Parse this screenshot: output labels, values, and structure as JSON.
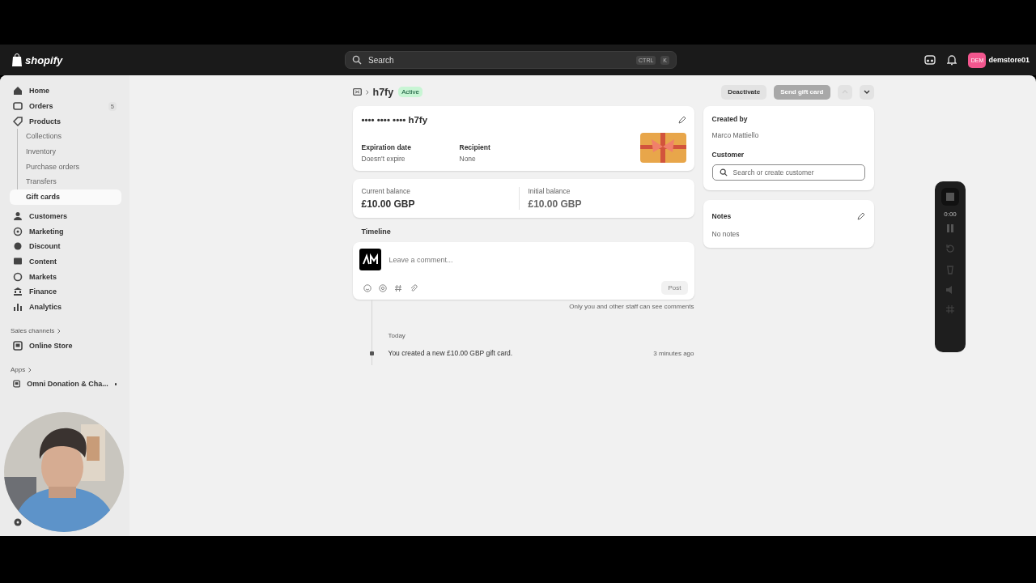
{
  "topbar": {
    "logo": "shopify",
    "search": {
      "placeholder": "Search",
      "keys": [
        "CTRL",
        "K"
      ]
    },
    "store": {
      "badge": "DEM",
      "name": "demstore01"
    }
  },
  "sidebar": {
    "items": [
      {
        "label": "Home",
        "selected": false
      },
      {
        "label": "Orders",
        "badge": "5",
        "selected": false
      },
      {
        "label": "Products",
        "selected": false,
        "children": [
          {
            "label": "Collections",
            "selected": false
          },
          {
            "label": "Inventory",
            "selected": false
          },
          {
            "label": "Purchase orders",
            "selected": false
          },
          {
            "label": "Transfers",
            "selected": false
          },
          {
            "label": "Gift cards",
            "selected": true
          }
        ]
      },
      {
        "label": "Customers",
        "selected": false
      },
      {
        "label": "Marketing",
        "selected": false
      },
      {
        "label": "Discount",
        "selected": false
      },
      {
        "label": "Content",
        "selected": false
      },
      {
        "label": "Markets",
        "selected": false
      },
      {
        "label": "Finance",
        "selected": false
      },
      {
        "label": "Analytics",
        "selected": false
      }
    ],
    "sections": [
      {
        "title": "Sales channels",
        "items": [
          {
            "label": "Online Store",
            "pinned": false
          }
        ]
      },
      {
        "title": "Apps",
        "items": [
          {
            "label": "Omni Donation & Cha...",
            "pinned": true
          }
        ]
      }
    ]
  },
  "page": {
    "title": "h7fy",
    "status": "Active",
    "actions": [
      {
        "label": "Deactivate",
        "disabled": false
      },
      {
        "label": "Send gift card",
        "disabled": true
      }
    ],
    "pager": [
      {
        "kind": "prev",
        "disabled": true
      },
      {
        "kind": "next",
        "disabled": false
      }
    ]
  },
  "card": {
    "code": "•••• •••• •••• h7fy",
    "fields": [
      {
        "label": "Expiration date",
        "value": "Doesn't expire"
      },
      {
        "label": "Recipient",
        "value": "None"
      }
    ]
  },
  "balances": [
    {
      "label": "Current balance",
      "value": "£10.00 GBP"
    },
    {
      "label": "Initial balance",
      "value": "£10.00 GBP"
    }
  ],
  "timeline": {
    "title": "Timeline",
    "placeholder": "Leave a comment...",
    "post": "Post",
    "note": "Only you and other staff can see comments",
    "date": "Today",
    "events": [
      {
        "text": "You created a new £10.00 GBP gift card.",
        "time": "3 minutes ago"
      }
    ]
  },
  "side": {
    "created_label": "Created by",
    "created_value": "Marco Mattiello",
    "customer_label": "Customer",
    "customer_placeholder": "Search or create customer",
    "notes_label": "Notes",
    "notes_value": "No notes"
  },
  "recorder": {
    "time": "0:00"
  }
}
